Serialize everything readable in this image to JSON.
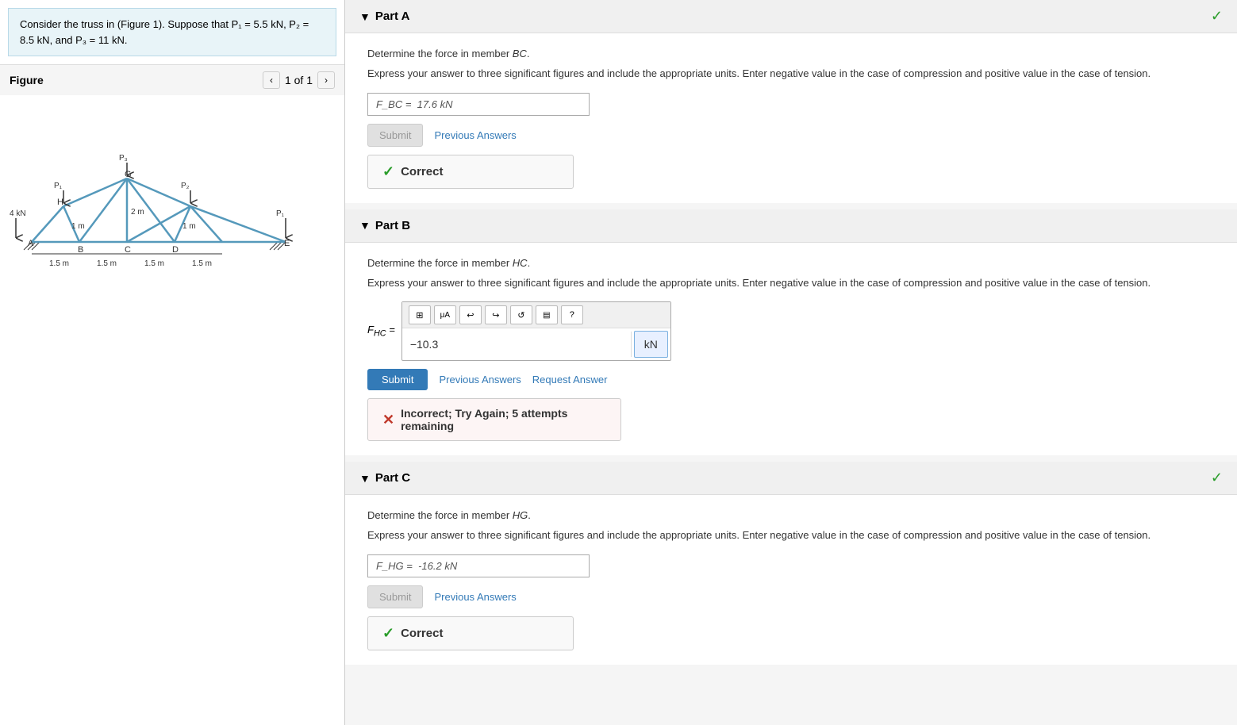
{
  "leftPanel": {
    "problemStatement": "Consider the truss in (Figure 1). Suppose that P₁ = 5.5 kN, P₂ = 8.5 kN, and P₃ = 11 kN.",
    "figureTitle": "Figure",
    "figureNav": "1 of 1"
  },
  "partA": {
    "label": "Part A",
    "checkmark": "✓",
    "determineLabel": "Determine the force in member BC.",
    "instructions": "Express your answer to three significant figures and include the appropriate units. Enter negative value in the case of compression and positive value in the case of tension.",
    "answerLabel": "F_BC =",
    "answerValue": "17.6 kN",
    "submitLabel": "Submit",
    "previousAnswersLabel": "Previous Answers",
    "correctLabel": "Correct"
  },
  "partB": {
    "label": "Part B",
    "determineLabel": "Determine the force in member HC.",
    "instructions": "Express your answer to three significant figures and include the appropriate units. Enter negative value in the case of compression and positive value in the case of tension.",
    "answerLabel": "F_HC =",
    "answerValue": "−10.3",
    "answerUnit": "kN",
    "submitLabel": "Submit",
    "previousAnswersLabel": "Previous Answers",
    "requestAnswerLabel": "Request Answer",
    "incorrectLabel": "Incorrect; Try Again; 5 attempts remaining",
    "toolbarButtons": [
      "⊞",
      "μA",
      "↩",
      "↪",
      "↺",
      "▤",
      "?"
    ]
  },
  "partC": {
    "label": "Part C",
    "checkmark": "✓",
    "determineLabel": "Determine the force in member HG.",
    "instructions": "Express your answer to three significant figures and include the appropriate units. Enter negative value in the case of compression and positive value in the case of tension.",
    "answerLabel": "F_HG =",
    "answerValue": "-16.2 kN",
    "submitLabel": "Submit",
    "previousAnswersLabel": "Previous Answers",
    "correctLabel": "Correct"
  }
}
